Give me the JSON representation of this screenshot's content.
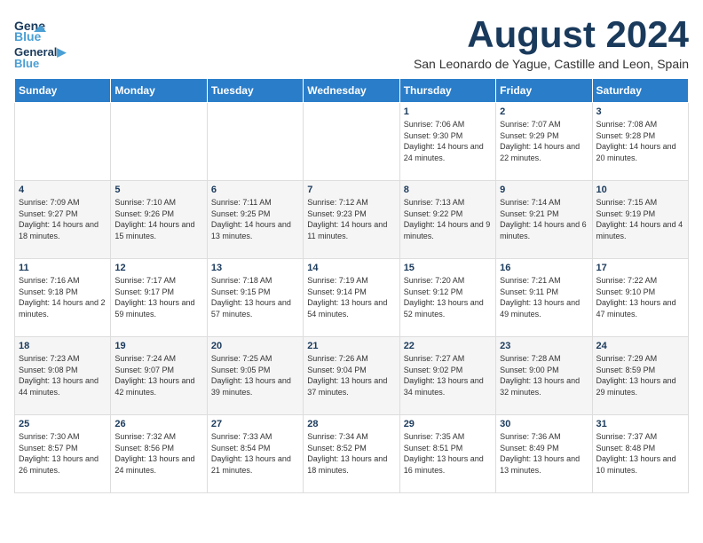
{
  "logo": {
    "line1": "General",
    "line2": "Blue",
    "tagline": "Blue"
  },
  "title": "August 2024",
  "subtitle": "San Leonardo de Yague, Castille and Leon, Spain",
  "weekdays": [
    "Sunday",
    "Monday",
    "Tuesday",
    "Wednesday",
    "Thursday",
    "Friday",
    "Saturday"
  ],
  "weeks": [
    [
      {
        "day": "",
        "info": ""
      },
      {
        "day": "",
        "info": ""
      },
      {
        "day": "",
        "info": ""
      },
      {
        "day": "",
        "info": ""
      },
      {
        "day": "1",
        "info": "Sunrise: 7:06 AM\nSunset: 9:30 PM\nDaylight: 14 hours\nand 24 minutes."
      },
      {
        "day": "2",
        "info": "Sunrise: 7:07 AM\nSunset: 9:29 PM\nDaylight: 14 hours\nand 22 minutes."
      },
      {
        "day": "3",
        "info": "Sunrise: 7:08 AM\nSunset: 9:28 PM\nDaylight: 14 hours\nand 20 minutes."
      }
    ],
    [
      {
        "day": "4",
        "info": "Sunrise: 7:09 AM\nSunset: 9:27 PM\nDaylight: 14 hours\nand 18 minutes."
      },
      {
        "day": "5",
        "info": "Sunrise: 7:10 AM\nSunset: 9:26 PM\nDaylight: 14 hours\nand 15 minutes."
      },
      {
        "day": "6",
        "info": "Sunrise: 7:11 AM\nSunset: 9:25 PM\nDaylight: 14 hours\nand 13 minutes."
      },
      {
        "day": "7",
        "info": "Sunrise: 7:12 AM\nSunset: 9:23 PM\nDaylight: 14 hours\nand 11 minutes."
      },
      {
        "day": "8",
        "info": "Sunrise: 7:13 AM\nSunset: 9:22 PM\nDaylight: 14 hours\nand 9 minutes."
      },
      {
        "day": "9",
        "info": "Sunrise: 7:14 AM\nSunset: 9:21 PM\nDaylight: 14 hours\nand 6 minutes."
      },
      {
        "day": "10",
        "info": "Sunrise: 7:15 AM\nSunset: 9:19 PM\nDaylight: 14 hours\nand 4 minutes."
      }
    ],
    [
      {
        "day": "11",
        "info": "Sunrise: 7:16 AM\nSunset: 9:18 PM\nDaylight: 14 hours\nand 2 minutes."
      },
      {
        "day": "12",
        "info": "Sunrise: 7:17 AM\nSunset: 9:17 PM\nDaylight: 13 hours\nand 59 minutes."
      },
      {
        "day": "13",
        "info": "Sunrise: 7:18 AM\nSunset: 9:15 PM\nDaylight: 13 hours\nand 57 minutes."
      },
      {
        "day": "14",
        "info": "Sunrise: 7:19 AM\nSunset: 9:14 PM\nDaylight: 13 hours\nand 54 minutes."
      },
      {
        "day": "15",
        "info": "Sunrise: 7:20 AM\nSunset: 9:12 PM\nDaylight: 13 hours\nand 52 minutes."
      },
      {
        "day": "16",
        "info": "Sunrise: 7:21 AM\nSunset: 9:11 PM\nDaylight: 13 hours\nand 49 minutes."
      },
      {
        "day": "17",
        "info": "Sunrise: 7:22 AM\nSunset: 9:10 PM\nDaylight: 13 hours\nand 47 minutes."
      }
    ],
    [
      {
        "day": "18",
        "info": "Sunrise: 7:23 AM\nSunset: 9:08 PM\nDaylight: 13 hours\nand 44 minutes."
      },
      {
        "day": "19",
        "info": "Sunrise: 7:24 AM\nSunset: 9:07 PM\nDaylight: 13 hours\nand 42 minutes."
      },
      {
        "day": "20",
        "info": "Sunrise: 7:25 AM\nSunset: 9:05 PM\nDaylight: 13 hours\nand 39 minutes."
      },
      {
        "day": "21",
        "info": "Sunrise: 7:26 AM\nSunset: 9:04 PM\nDaylight: 13 hours\nand 37 minutes."
      },
      {
        "day": "22",
        "info": "Sunrise: 7:27 AM\nSunset: 9:02 PM\nDaylight: 13 hours\nand 34 minutes."
      },
      {
        "day": "23",
        "info": "Sunrise: 7:28 AM\nSunset: 9:00 PM\nDaylight: 13 hours\nand 32 minutes."
      },
      {
        "day": "24",
        "info": "Sunrise: 7:29 AM\nSunset: 8:59 PM\nDaylight: 13 hours\nand 29 minutes."
      }
    ],
    [
      {
        "day": "25",
        "info": "Sunrise: 7:30 AM\nSunset: 8:57 PM\nDaylight: 13 hours\nand 26 minutes."
      },
      {
        "day": "26",
        "info": "Sunrise: 7:32 AM\nSunset: 8:56 PM\nDaylight: 13 hours\nand 24 minutes."
      },
      {
        "day": "27",
        "info": "Sunrise: 7:33 AM\nSunset: 8:54 PM\nDaylight: 13 hours\nand 21 minutes."
      },
      {
        "day": "28",
        "info": "Sunrise: 7:34 AM\nSunset: 8:52 PM\nDaylight: 13 hours\nand 18 minutes."
      },
      {
        "day": "29",
        "info": "Sunrise: 7:35 AM\nSunset: 8:51 PM\nDaylight: 13 hours\nand 16 minutes."
      },
      {
        "day": "30",
        "info": "Sunrise: 7:36 AM\nSunset: 8:49 PM\nDaylight: 13 hours\nand 13 minutes."
      },
      {
        "day": "31",
        "info": "Sunrise: 7:37 AM\nSunset: 8:48 PM\nDaylight: 13 hours\nand 10 minutes."
      }
    ]
  ]
}
